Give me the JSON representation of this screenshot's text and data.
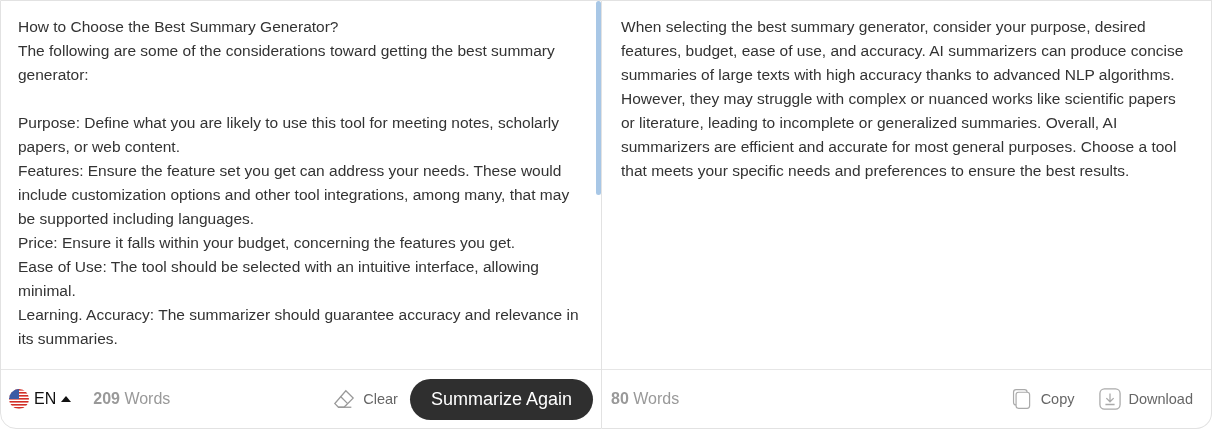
{
  "input": {
    "intro": [
      "How to Choose the Best Summary Generator?",
      "The following are some of the considerations toward getting the best summary generator:"
    ],
    "points": [
      "Purpose: Define what you are likely to use this tool for meeting notes, scholarly papers, or web content.",
      "Features: Ensure the feature set you get can address your needs. These would include customization options and other tool integrations, among many, that may be supported including languages.",
      "Price: Ensure it falls within your budget, concerning the features you get.",
      "Ease of Use: The tool should be selected with an intuitive interface, allowing minimal.",
      "Learning. Accuracy: The summarizer should guarantee accuracy and relevance in its summaries."
    ],
    "language": "EN",
    "word_count": "209",
    "word_label": "Words",
    "clear": "Clear",
    "summarize": "Summarize Again"
  },
  "output": {
    "text": "When selecting the best summary generator, consider your purpose, desired features, budget, ease of use, and accuracy. AI summarizers can produce concise summaries of large texts with high accuracy thanks to advanced NLP algorithms. However, they may struggle with complex or nuanced works like scientific papers or literature, leading to incomplete or generalized summaries. Overall, AI summarizers are efficient and accurate for most general purposes. Choose a tool that meets your specific needs and preferences to ensure the best results.",
    "word_count": "80",
    "word_label": "Words",
    "copy": "Copy",
    "download": "Download"
  }
}
